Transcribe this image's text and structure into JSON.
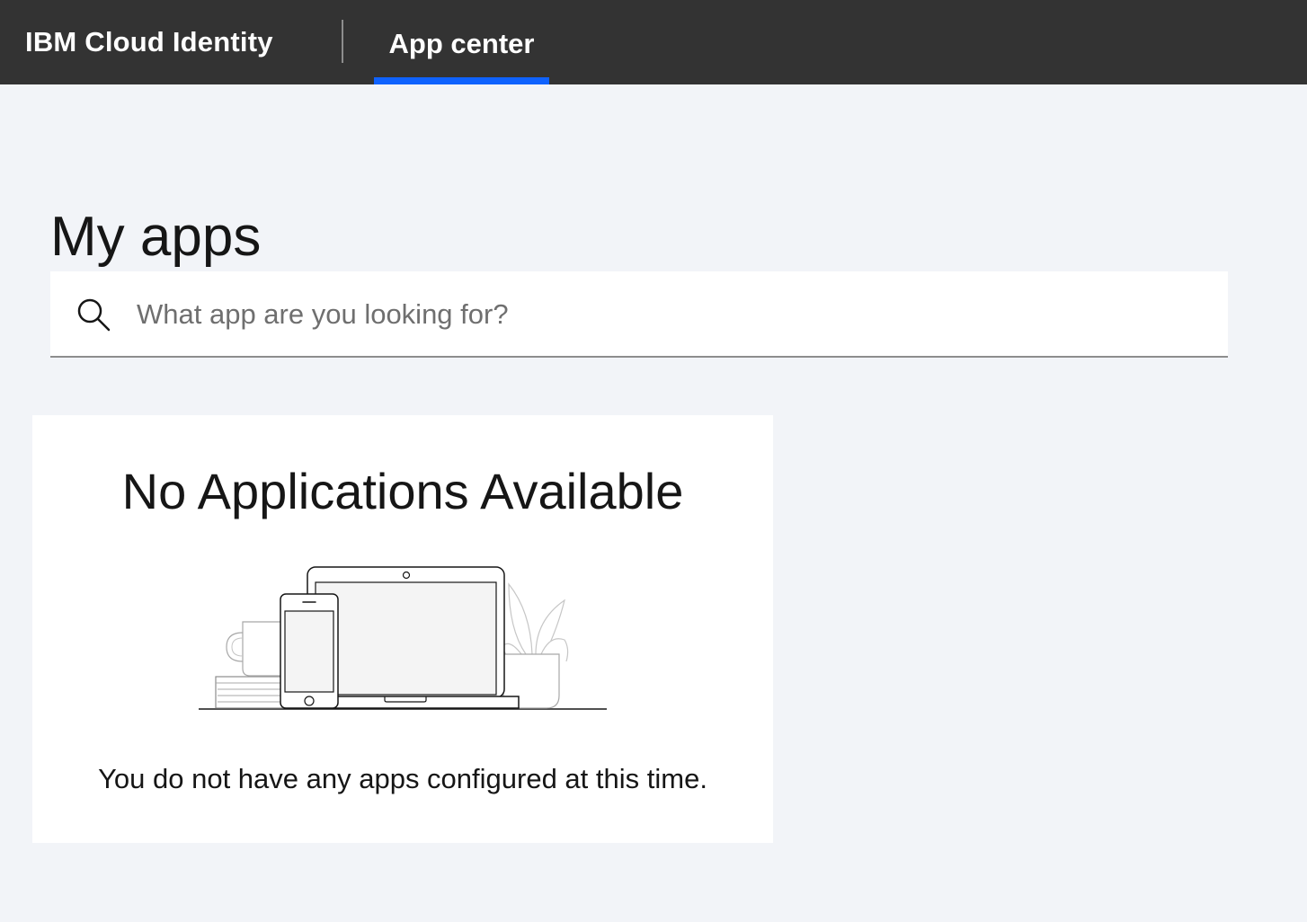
{
  "header": {
    "brand": "IBM Cloud Identity",
    "nav_tab": "App center"
  },
  "main": {
    "title": "My apps",
    "search": {
      "placeholder": "What app are you looking for?",
      "value": "",
      "icon": "search-icon"
    },
    "empty_state": {
      "title": "No Applications Available",
      "message": "You do not have any apps configured at this time.",
      "illustration": "devices-illustration"
    }
  },
  "colors": {
    "header_bg": "#333333",
    "accent": "#0f62fe",
    "page_bg": "#f2f4f8",
    "card_bg": "#ffffff"
  }
}
